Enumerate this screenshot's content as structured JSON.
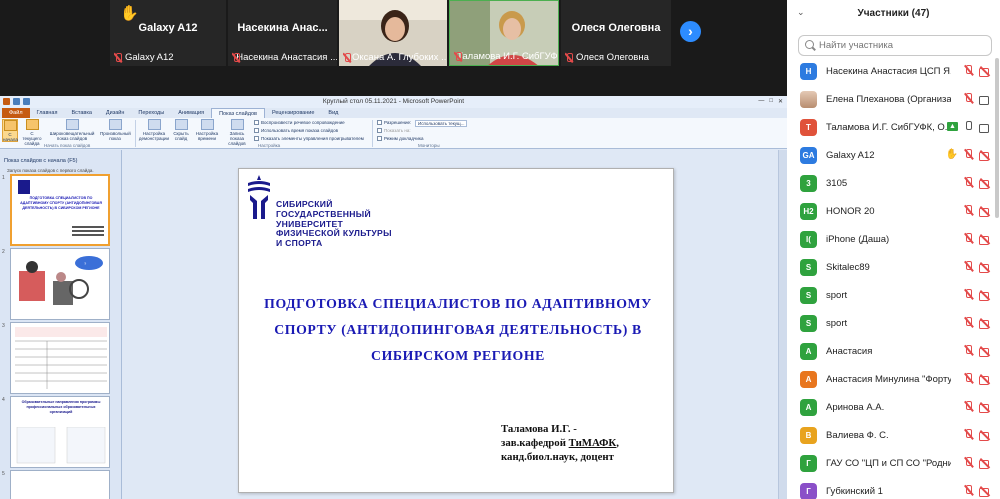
{
  "strip": {
    "tiles": [
      {
        "title": "Galaxy A12",
        "label": "Galaxy A12"
      },
      {
        "title": "Насекина  Анас...",
        "label": "Насекина Анастасия ..."
      },
      {
        "title": "",
        "label": "Оксана А. Глубоких ..."
      },
      {
        "title": "",
        "label": "Таламова И.Г. СибГУФК..."
      },
      {
        "title": "Олеся Олеговна",
        "label": "Олеся Олеговна"
      }
    ],
    "next_label": "›"
  },
  "ppt": {
    "window_title": "Круглый стол 05.11.2021  -  Microsoft PowerPoint",
    "window_controls": [
      "—",
      "□",
      "✕"
    ],
    "tabs": [
      "Файл",
      "Главная",
      "Вставка",
      "Дизайн",
      "Переходы",
      "Анимация",
      "Показ слайдов",
      "Рецензирование",
      "Вид"
    ],
    "ribbon": {
      "buttons": [
        "С начала",
        "С текущего слайда",
        "Широковещательный показ слайдов",
        "Произвольный показ",
        "Настройка демонстрации",
        "Скрыть слайд",
        "Настройка времени",
        "Запись показа слайдов"
      ],
      "checks": [
        "Воспроизвести речевое сопровождение",
        "Использовать время показа слайдов",
        "Показать элементы управления проигрывателем"
      ],
      "monitor_checks": [
        "Разрешение:",
        "Показать на:",
        "Режим докладчика"
      ],
      "monitor_value": "Использовать текущ...",
      "groups": [
        "Начать показ слайдов",
        "Настройка",
        "Мониторы"
      ]
    },
    "left_pane": {
      "header": "Показ слайдов с начала (F5)",
      "subheader": "Запуск показа слайдов с первого слайда."
    },
    "thumbs": [
      {
        "num": "1",
        "text": "ПОДГОТОВКА СПЕЦИАЛИСТОВ ПО АДАПТИВНОМУ СПОРТУ (АНТИДОПИНГОВАЯ ДЕЯТЕЛЬНОСТЬ) В СИБИРСКОМ РЕГИОНЕ"
      },
      {
        "num": "2",
        "text": ""
      },
      {
        "num": "3",
        "text": ""
      },
      {
        "num": "4",
        "text": "Образовательные направления программы профессиональных образовательных организаций"
      },
      {
        "num": "5",
        "text": ""
      }
    ]
  },
  "slide": {
    "logo_lines": [
      "Сибирский",
      "государственный",
      "университет",
      "физической культуры",
      "и спорта"
    ],
    "title_lines": [
      "ПОДГОТОВКА СПЕЦИАЛИСТОВ ПО АДАПТИВНОМУ",
      "СПОРТУ (АНТИДОПИНГОВАЯ ДЕЯТЕЛЬНОСТЬ) В",
      "СИБИРСКОМ  РЕГИОНЕ"
    ],
    "author_name": "Таламова  И.Г. -",
    "author_pos_a": "зав.кафедрой ",
    "author_pos_b": "ТиМАФК",
    "author_pos_c": ",",
    "author_deg": "канд.биол.наук, доцент"
  },
  "panel": {
    "title": "Участники (47)",
    "search_placeholder": "Найти участника",
    "participants": [
      {
        "initials": "Н",
        "color": "#2d7be0",
        "name": "Насекина Анастасия ЦСП Я...",
        "me": "(Я)",
        "mic": "off",
        "cam": "off"
      },
      {
        "initials": "",
        "color": "photo",
        "name": "Елена Плеханова (Организатор)",
        "mic": "off",
        "cam": "on"
      },
      {
        "initials": "Т",
        "color": "#e0523a",
        "name": "Таламова И.Г. СибГУФК, О...",
        "share": true,
        "mic": "on",
        "cam": "on"
      },
      {
        "initials": "GA",
        "color": "#2d7be0",
        "name": "Galaxy A12",
        "hand": true,
        "mic": "off",
        "cam": "off"
      },
      {
        "initials": "3",
        "color": "#2fa23e",
        "name": "3105",
        "mic": "off",
        "cam": "off"
      },
      {
        "initials": "H2",
        "color": "#2fa23e",
        "name": "HONOR 20",
        "mic": "off",
        "cam": "off"
      },
      {
        "initials": "I(",
        "color": "#2fa23e",
        "name": "iPhone (Даша)",
        "mic": "off",
        "cam": "off"
      },
      {
        "initials": "S",
        "color": "#2fa23e",
        "name": "Skitalec89",
        "mic": "off",
        "cam": "off"
      },
      {
        "initials": "S",
        "color": "#2fa23e",
        "name": "sport",
        "mic": "off",
        "cam": "off"
      },
      {
        "initials": "S",
        "color": "#2fa23e",
        "name": "sport",
        "mic": "off",
        "cam": "off"
      },
      {
        "initials": "А",
        "color": "#2fa23e",
        "name": "Анастасия",
        "mic": "off",
        "cam": "off"
      },
      {
        "initials": "А",
        "color": "#e8761e",
        "name": "Анастасия Минулина \"Фортуна...",
        "mic": "off",
        "cam": "off"
      },
      {
        "initials": "А",
        "color": "#2fa23e",
        "name": "Аринова А.А.",
        "mic": "off",
        "cam": "off"
      },
      {
        "initials": "В",
        "color": "#e8a31e",
        "name": "Валиева Ф. С.",
        "mic": "off",
        "cam": "off"
      },
      {
        "initials": "Г",
        "color": "#2fa23e",
        "name": "ГАУ СО \"ЦП и СП СО \"Родник\" ...",
        "mic": "off",
        "cam": "off"
      },
      {
        "initials": "Г",
        "color": "#8a4fc8",
        "name": "Губкинский 1",
        "mic": "off",
        "cam": "off"
      }
    ]
  }
}
